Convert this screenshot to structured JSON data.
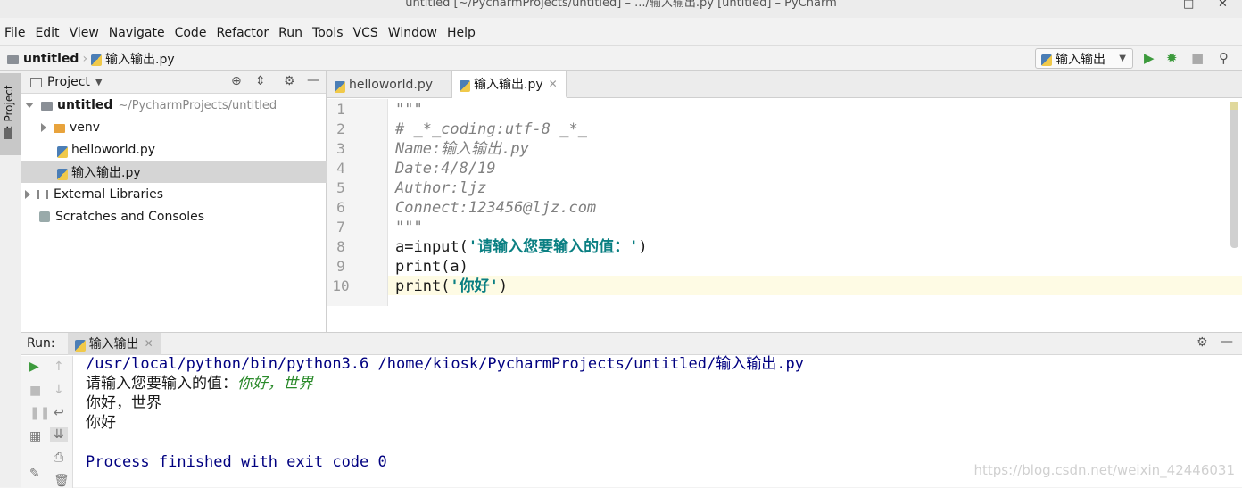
{
  "window": {
    "title": "untitled [~/PycharmProjects/untitled] – .../输入输出.py [untitled] – PyCharm"
  },
  "menu": [
    "File",
    "Edit",
    "View",
    "Navigate",
    "Code",
    "Refactor",
    "Run",
    "Tools",
    "VCS",
    "Window",
    "Help"
  ],
  "breadcrumb": {
    "project": "untitled",
    "file": "输入输出.py"
  },
  "toolbar": {
    "run_config": "输入输出"
  },
  "left_stripe": {
    "project_tab": "1: Project"
  },
  "project_panel": {
    "title": "Project",
    "root_name": "untitled",
    "root_path": "~/PycharmProjects/untitled",
    "items": [
      {
        "label": "venv"
      },
      {
        "label": "helloworld.py"
      },
      {
        "label": "输入输出.py"
      },
      {
        "label": "External Libraries"
      },
      {
        "label": "Scratches and Consoles"
      }
    ]
  },
  "editor": {
    "tabs": [
      {
        "label": "helloworld.py"
      },
      {
        "label": "输入输出.py"
      }
    ],
    "line_numbers": [
      "1",
      "2",
      "3",
      "4",
      "5",
      "6",
      "7",
      "8",
      "9",
      "10"
    ],
    "lines": {
      "l1": "\"\"\"",
      "l2": "# _*_coding:utf-8 _*_",
      "l3": "Name:输入输出.py",
      "l4": "Date:4/8/19",
      "l5": "Author:ljz",
      "l6": "Connect:123456@ljz.com",
      "l7": "\"\"\"",
      "l8a": "a=input(",
      "l8b": "'请输入您要输入的值：'",
      "l8c": ")",
      "l9": "print(a)",
      "l10a": "print(",
      "l10b": "'你好'",
      "l10c": ")"
    }
  },
  "run_panel": {
    "label": "Run:",
    "tab": "输入输出",
    "output": {
      "cmd": "/usr/local/python/bin/python3.6 /home/kiosk/PycharmProjects/untitled/输入输出.py",
      "prompt": "请输入您要输入的值：",
      "input": "你好，世界",
      "line2": "你好，世界",
      "line3": "你好",
      "exit": "Process finished with exit code 0"
    }
  },
  "watermark": "https://blog.csdn.net/weixin_42446031"
}
